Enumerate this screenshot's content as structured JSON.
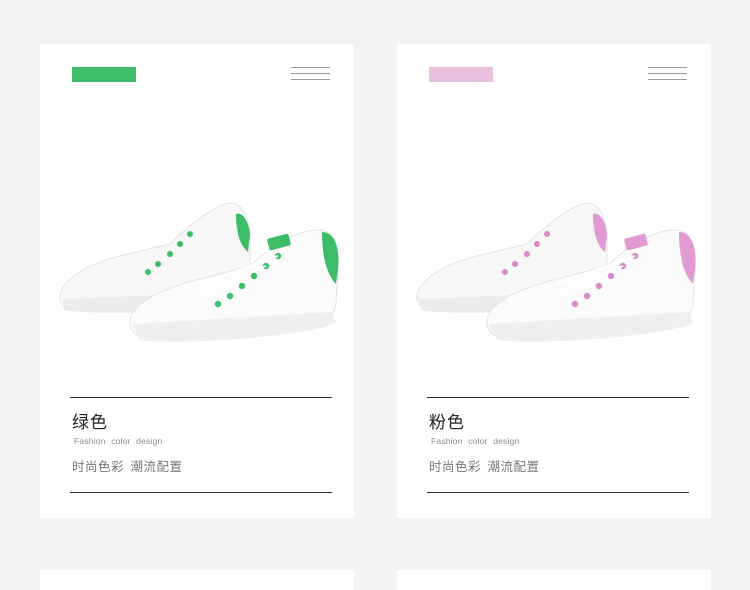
{
  "cards": [
    {
      "color_name": "绿色",
      "subtitle": "Fashion color design",
      "tagline": "时尚色彩 潮流配置",
      "accent": "#3ebd68",
      "icon": "menu-icon"
    },
    {
      "color_name": "粉色",
      "subtitle": "Fashion color design",
      "tagline": "时尚色彩 潮流配置",
      "accent": "#e9bedf",
      "icon": "menu-icon"
    }
  ]
}
